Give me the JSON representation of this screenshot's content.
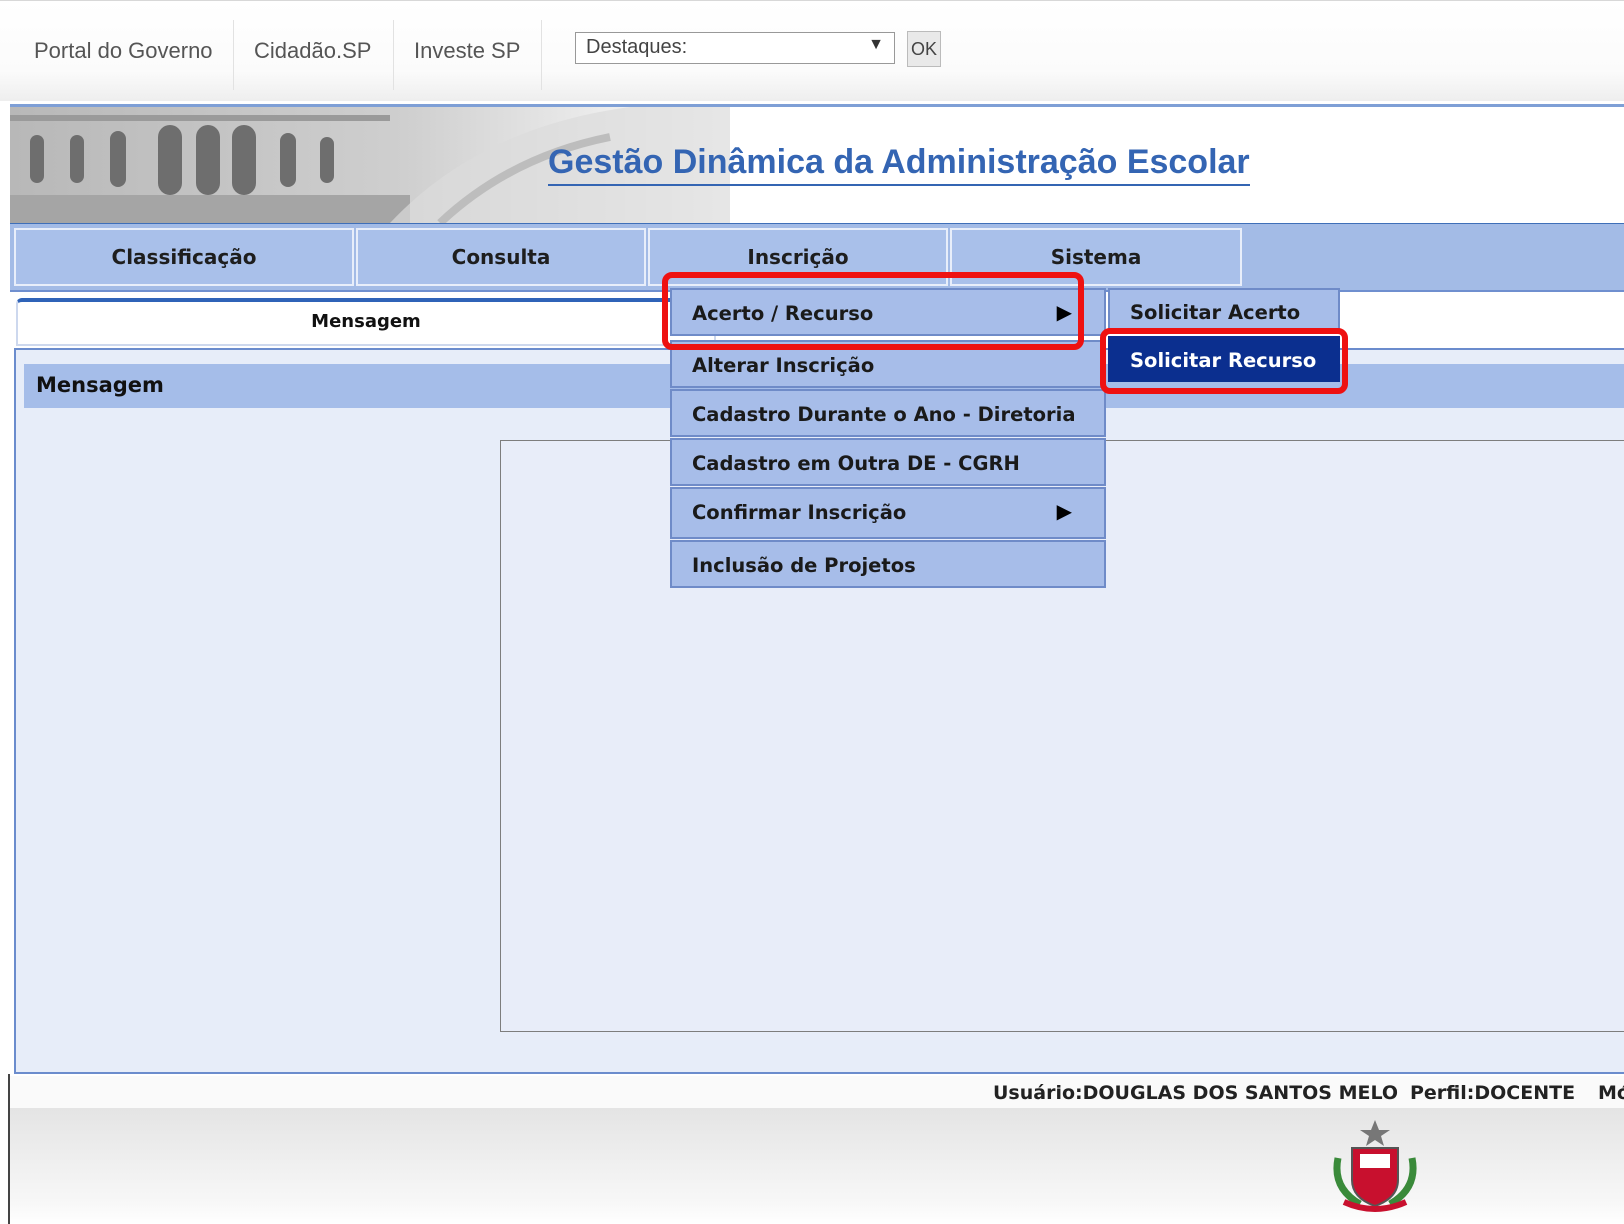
{
  "gov_bar": {
    "links": [
      "Portal do Governo",
      "Cidadão.SP",
      "Investe SP"
    ],
    "select": {
      "value": "Destaques:"
    },
    "ok_label": "OK"
  },
  "header": {
    "title": "Gestão Dinâmica da Administração Escolar"
  },
  "nav": {
    "items": [
      "Classificação",
      "Consulta",
      "Inscrição",
      "Sistema"
    ]
  },
  "tab": {
    "label": "Mensagem"
  },
  "panel": {
    "title": "Mensagem"
  },
  "menu": {
    "items": [
      {
        "label": "Acerto / Recurso",
        "submenu": true
      },
      {
        "label": "Alterar Inscrição",
        "submenu": false
      },
      {
        "label": "Cadastro Durante o Ano - Diretoria",
        "submenu": false
      },
      {
        "label": "Cadastro em Outra DE - CGRH",
        "submenu": false
      },
      {
        "label": "Confirmar Inscrição",
        "submenu": true
      },
      {
        "label": "Inclusão de Projetos",
        "submenu": false
      }
    ],
    "submenu_items": [
      "Solicitar Acerto",
      "Solicitar Recurso"
    ],
    "active_submenu_item": "Solicitar Recurso"
  },
  "status": {
    "user": "Usuário:DOUGLAS DOS SANTOS MELO",
    "profile": "Perfil:DOCENTE",
    "truncated": "Mó"
  },
  "colors": {
    "nav_bg": "#a9c0ea",
    "menu_bg": "#a7bde9",
    "active_item_bg": "#0b2f8f",
    "highlight": "#ee1111",
    "title": "#3465b3"
  },
  "icons": {
    "submenu_arrow": "triangle-right-icon",
    "select_caret": "chevron-down-icon",
    "footer_logo": "sp-state-seal-icon"
  }
}
